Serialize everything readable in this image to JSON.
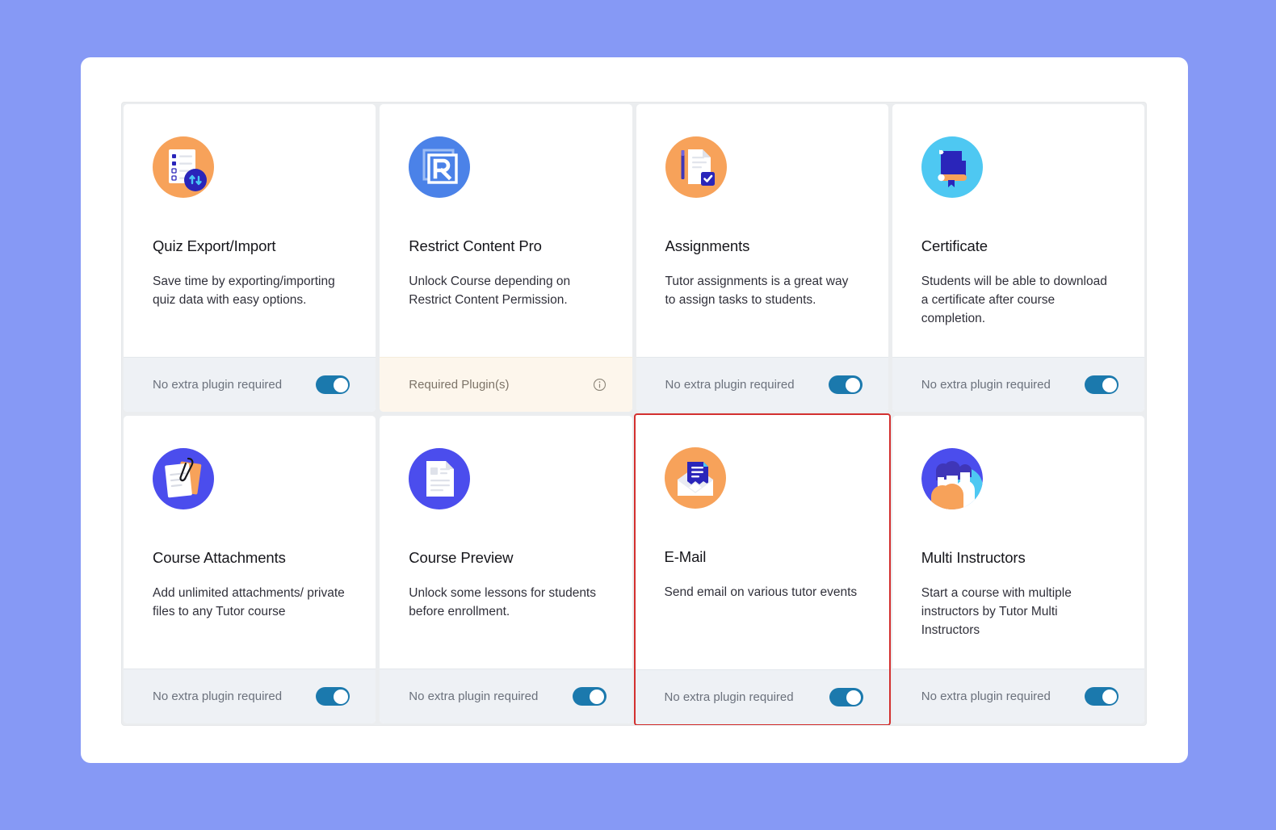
{
  "theme": {
    "background": "#8699f5",
    "panel": "#ffffff",
    "grid_gap": "#ebedef",
    "footer_default": "#eef1f5",
    "footer_required": "#fdf6ec",
    "toggle_on": "#1b79ad",
    "highlight_border": "#d3302f"
  },
  "cards": [
    {
      "id": "quiz-export-import",
      "title": "Quiz Export/Import",
      "description": "Save time by exporting/importing quiz data with easy options.",
      "icon": "quiz-export-import-icon",
      "icon_bg": "#f7a25a",
      "footer_label": "No extra plugin required",
      "footer_type": "toggle",
      "toggle_on": true,
      "highlighted": false
    },
    {
      "id": "restrict-content-pro",
      "title": "Restrict Content Pro",
      "description": "Unlock Course depending on Restrict Content Permission.",
      "icon": "restrict-content-pro-icon",
      "icon_bg": "#4b82e8",
      "footer_label": "Required Plugin(s)",
      "footer_type": "info",
      "toggle_on": false,
      "highlighted": false
    },
    {
      "id": "assignments",
      "title": "Assignments",
      "description": "Tutor assignments is a great way to assign tasks to students.",
      "icon": "assignments-icon",
      "icon_bg": "#f7a25a",
      "footer_label": "No extra plugin required",
      "footer_type": "toggle",
      "toggle_on": true,
      "highlighted": false
    },
    {
      "id": "certificate",
      "title": "Certificate",
      "description": "Students will be able to download a certificate after course completion.",
      "icon": "certificate-icon",
      "icon_bg": "#4ec8f2",
      "footer_label": "No extra plugin required",
      "footer_type": "toggle",
      "toggle_on": true,
      "highlighted": false
    },
    {
      "id": "course-attachments",
      "title": "Course Attachments",
      "description": "Add unlimited attachments/ private files to any Tutor course",
      "icon": "course-attachments-icon",
      "icon_bg": "#4b4ded",
      "footer_label": "No extra plugin required",
      "footer_type": "toggle",
      "toggle_on": true,
      "highlighted": false
    },
    {
      "id": "course-preview",
      "title": "Course Preview",
      "description": "Unlock some lessons for students before enrollment.",
      "icon": "course-preview-icon",
      "icon_bg": "#4b4ded",
      "footer_label": "No extra plugin required",
      "footer_type": "toggle",
      "toggle_on": true,
      "highlighted": false
    },
    {
      "id": "e-mail",
      "title": "E-Mail",
      "description": "Send email on various tutor events",
      "icon": "email-icon",
      "icon_bg": "#f7a25a",
      "footer_label": "No extra plugin required",
      "footer_type": "toggle",
      "toggle_on": true,
      "highlighted": true
    },
    {
      "id": "multi-instructors",
      "title": "Multi Instructors",
      "description": "Start a course with multiple instructors by Tutor Multi Instructors",
      "icon": "multi-instructors-icon",
      "icon_bg": "#4b4ded",
      "footer_label": "No extra plugin required",
      "footer_type": "toggle",
      "toggle_on": true,
      "highlighted": false
    }
  ]
}
